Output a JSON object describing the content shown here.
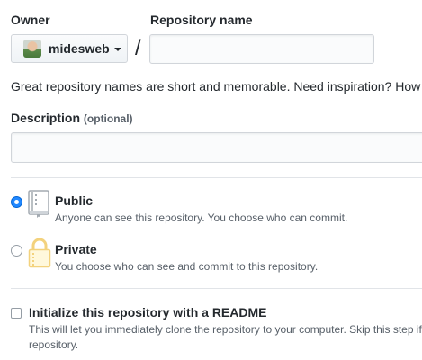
{
  "owner": {
    "label": "Owner",
    "selected": "midesweb",
    "avatar_icon": "user-avatar",
    "caret_icon": "caret-down-icon"
  },
  "separator": "/",
  "repo_name": {
    "label": "Repository name",
    "value": "",
    "placeholder": ""
  },
  "hint": "Great repository names are short and memorable. Need inspiration? How about",
  "description": {
    "label": "Description",
    "optional": "(optional)",
    "value": "",
    "placeholder": ""
  },
  "visibility": {
    "selected": "public",
    "options": [
      {
        "key": "public",
        "title": "Public",
        "desc": "Anyone can see this repository. You choose who can commit.",
        "icon": "repo-book-icon",
        "checked": true
      },
      {
        "key": "private",
        "title": "Private",
        "desc": "You choose who can see and commit to this repository.",
        "icon": "lock-icon",
        "checked": false
      }
    ]
  },
  "init": {
    "checked": false,
    "title": "Initialize this repository with a README",
    "desc_line1": "This will let you immediately clone the repository to your computer. Skip this step if you're importing an existing",
    "desc_line2": "repository."
  },
  "colors": {
    "accent": "#0366d6",
    "radio_fill": "#2188ff",
    "text": "#24292e",
    "muted": "#586069",
    "border": "#d1d5da",
    "divider": "#e1e4e8",
    "lock": "#f3d27d"
  }
}
